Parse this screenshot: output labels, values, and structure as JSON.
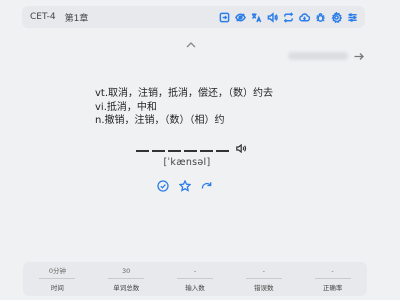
{
  "toolbar": {
    "dictionary": "CET-4",
    "chapter": "第1章",
    "icons": [
      "export-icon",
      "hide-icon",
      "translate-icon",
      "sound-icon",
      "loop-icon",
      "cloud-icon",
      "bug-icon",
      "settings-icon",
      "menu-icon"
    ]
  },
  "word": {
    "definitions": [
      "vt.取消，注销，抵消，偿还，（数）约去",
      "vi.抵消，中和",
      "n.撤销，注销，（数）（相）约"
    ],
    "letter_count": 6,
    "phonetic": "[ˈkænsəl]"
  },
  "colors": {
    "accent": "#2b7de9"
  },
  "stats": [
    {
      "value": "0分钟",
      "label": "时间"
    },
    {
      "value": "30",
      "label": "单词总数"
    },
    {
      "value": "-",
      "label": "输入数"
    },
    {
      "value": "-",
      "label": "错误数"
    },
    {
      "value": "-",
      "label": "正确率"
    }
  ]
}
